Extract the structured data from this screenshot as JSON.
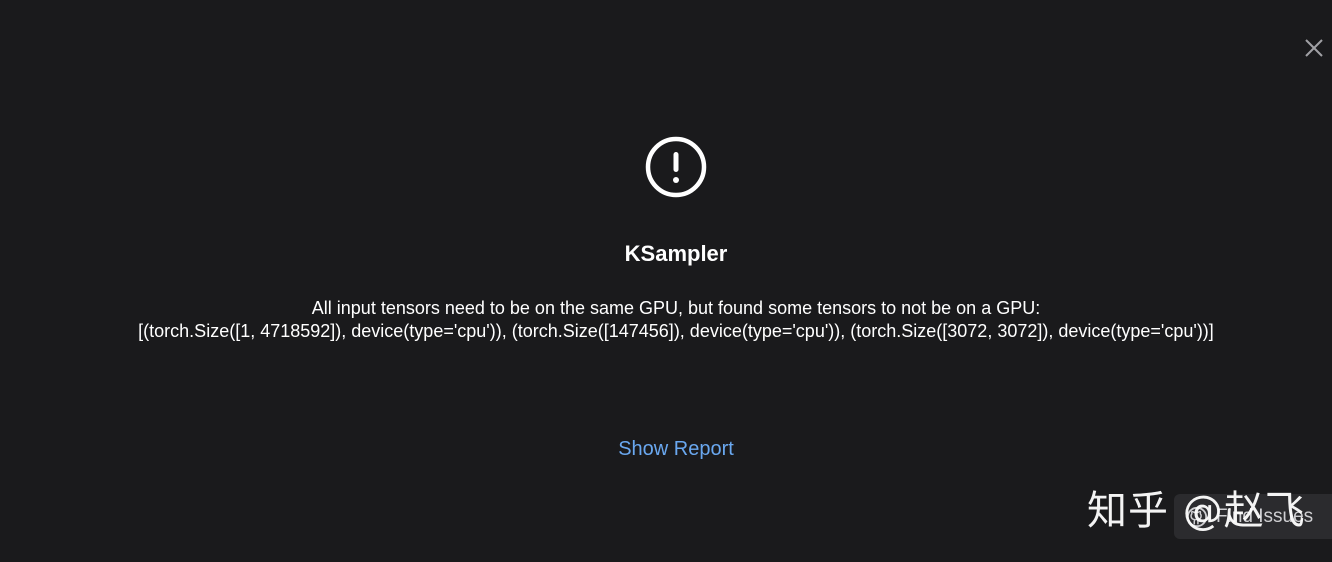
{
  "dialog": {
    "close_icon": "close-icon",
    "alert_icon": "alert-circle-icon",
    "title": "KSampler",
    "message_line1": "All input tensors need to be on the same GPU, but found some tensors to not be on a GPU:",
    "message_line2": "[(torch.Size([1, 4718592]), device(type='cpu')), (torch.Size([147456]), device(type='cpu')), (torch.Size([3072, 3072]), device(type='cpu'))]",
    "show_report_label": "Show Report",
    "accent_color": "#6aa8f0"
  },
  "find_issues": {
    "icon": "github-icon",
    "label": "Find Issues"
  },
  "watermark": {
    "text": "知乎 @赵飞"
  }
}
